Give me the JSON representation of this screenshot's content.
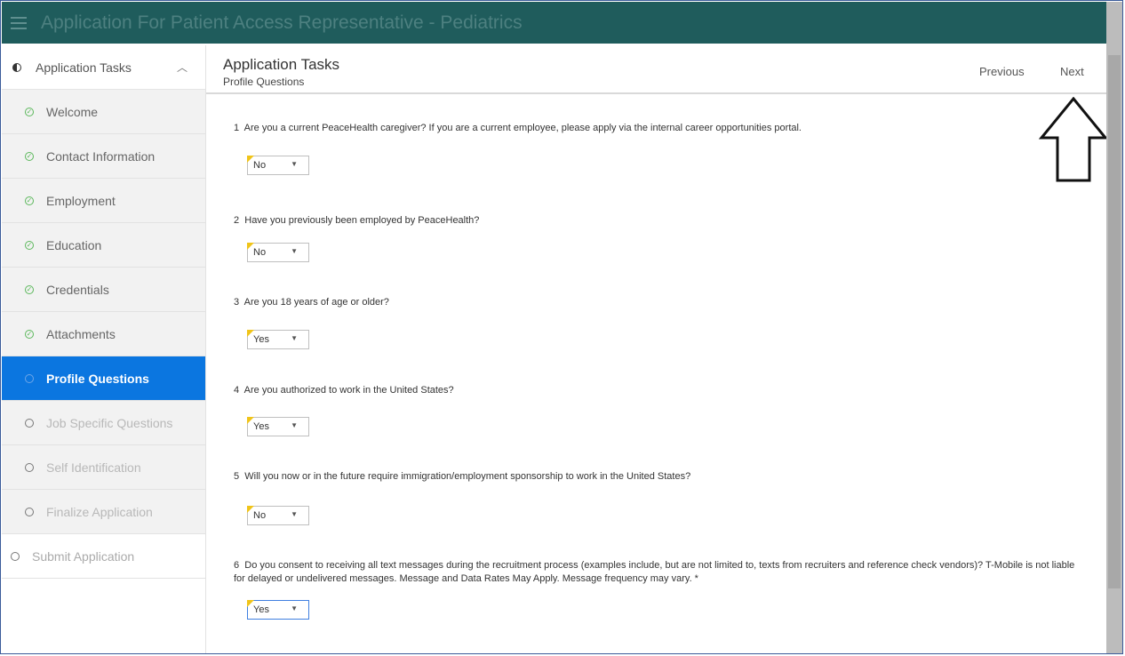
{
  "app": {
    "title": "Application For Patient Access Representative - Pediatrics"
  },
  "sidebar": {
    "header_label": "Application Tasks",
    "items": [
      {
        "label": "Welcome",
        "status": "done"
      },
      {
        "label": "Contact Information",
        "status": "done"
      },
      {
        "label": "Employment",
        "status": "done"
      },
      {
        "label": "Education",
        "status": "done"
      },
      {
        "label": "Credentials",
        "status": "done"
      },
      {
        "label": "Attachments",
        "status": "done"
      },
      {
        "label": "Profile Questions",
        "status": "active"
      },
      {
        "label": "Job Specific Questions",
        "status": "todo"
      },
      {
        "label": "Self Identification",
        "status": "todo"
      },
      {
        "label": "Finalize Application",
        "status": "todo"
      }
    ],
    "submit_label": "Submit Application"
  },
  "header": {
    "title": "Application Tasks",
    "subtitle": "Profile Questions",
    "previous_label": "Previous",
    "next_label": "Next"
  },
  "questions": [
    {
      "number": "1",
      "text": "Are you a current PeaceHealth caregiver? If you are a current employee, please apply via the internal career opportunities portal.",
      "answer": "No"
    },
    {
      "number": "2",
      "text": "Have you previously been employed by PeaceHealth?",
      "answer": "No"
    },
    {
      "number": "3",
      "text": "Are you 18 years of age or older?",
      "answer": "Yes"
    },
    {
      "number": "4",
      "text": "Are you authorized to work in the United States?",
      "answer": "Yes"
    },
    {
      "number": "5",
      "text": "Will you now or in the future require immigration/employment sponsorship to work in the United States?",
      "answer": "No"
    },
    {
      "number": "6",
      "text": "Do you consent to receiving all text messages during the recruitment process (examples include, but are not limited to, texts from recruiters and reference check vendors)? T-Mobile is not liable for delayed or undelivered messages. Message and Data Rates May Apply. Message frequency may vary. *",
      "answer": "Yes"
    }
  ],
  "colors": {
    "topbar": "#1f5c5c",
    "active_task": "#0b76e0",
    "done_check": "#5cb85c",
    "required_flag": "#f0c419"
  }
}
